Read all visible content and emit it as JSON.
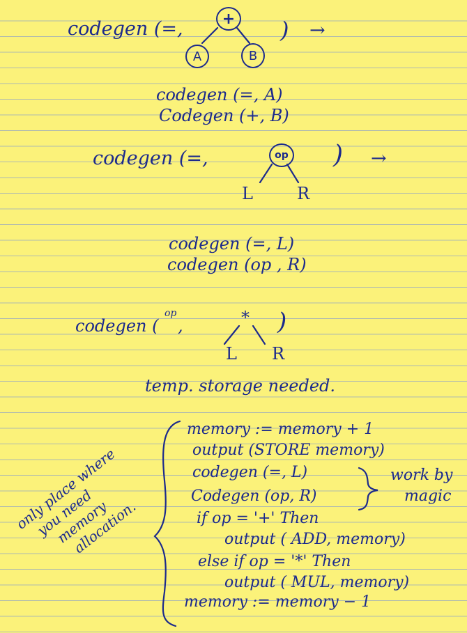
{
  "block1": {
    "call": "codegen (=,",
    "root": "+",
    "left": "A",
    "right": "B",
    "close": ")",
    "arrow": "→",
    "out1": "codegen (=, A)",
    "out2": "Codegen (+,  B)"
  },
  "block2": {
    "call": "codegen (=,",
    "root": "op",
    "left": "L",
    "right": "R",
    "close": ")",
    "arrow": "→",
    "out1": "codegen (=, L)",
    "out2": "codegen (op , R)"
  },
  "block3": {
    "call": "codegen (",
    "op": "op",
    "comma": ",",
    "root": "*",
    "left": "L",
    "right": "R",
    "close": ")",
    "note": "temp. storage needed."
  },
  "code": {
    "lines": [
      "memory := memory + 1",
      "output (STORE  memory)",
      "codegen (=, L)",
      "Codegen (op, R)",
      "if  op = '+' Then",
      "output ( ADD, memory)",
      "else if op = '*' Then",
      "output ( MUL, memory)",
      "memory := memory − 1"
    ],
    "side_note": [
      "work by",
      "magic"
    ]
  },
  "margin_note": [
    "only place where",
    "you need",
    "memory",
    "allocation."
  ]
}
